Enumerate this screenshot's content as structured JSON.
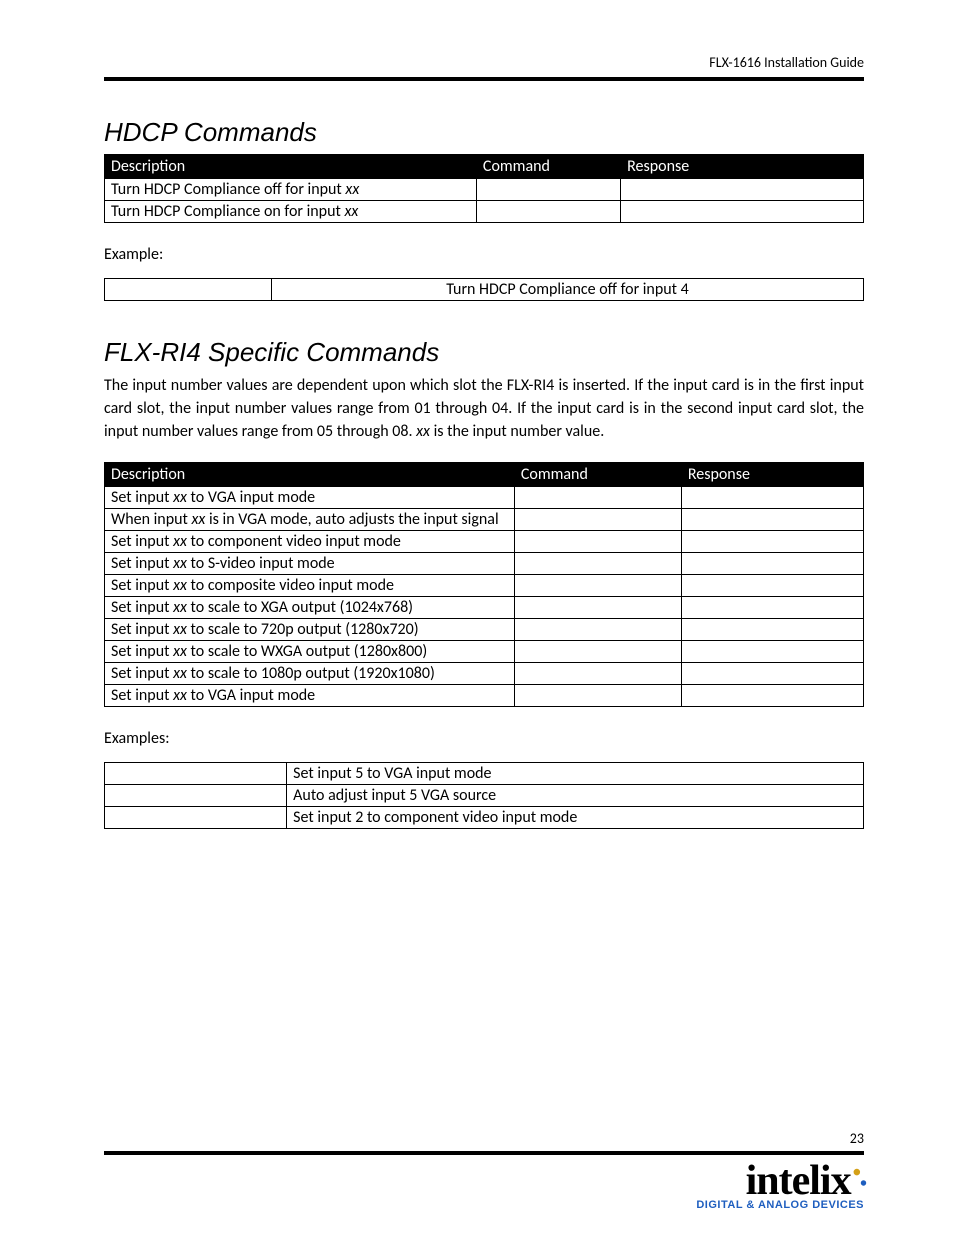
{
  "header": {
    "doc_title": "FLX-1616 Installation Guide"
  },
  "section1": {
    "title": "HDCP Commands",
    "headers": {
      "desc": "Description",
      "cmd": "Command",
      "resp": "Response"
    },
    "rows": [
      {
        "desc_pre": "Turn HDCP Compliance off for input ",
        "desc_it": "xx",
        "cmd": "",
        "resp": ""
      },
      {
        "desc_pre": "Turn HDCP Compliance on for input ",
        "desc_it": "xx",
        "cmd": "",
        "resp": ""
      }
    ],
    "example_label": "Example:",
    "example_rows": [
      {
        "c1": "",
        "c2": "Turn HDCP Compliance off for input 4"
      }
    ]
  },
  "section2": {
    "title": "FLX-RI4 Specific Commands",
    "paragraph_pre": "The input number values are dependent upon which slot the FLX-RI4 is inserted. If the input card is in the first input card slot, the input number values range from 01 through 04. If the input card is in the second input card slot, the input number values range from 05 through 08. ",
    "paragraph_it": "xx",
    "paragraph_post": " is the input number value.",
    "headers": {
      "desc": "Description",
      "cmd": "Command",
      "resp": "Response"
    },
    "rows": [
      {
        "p1": "Set input ",
        "it": "xx",
        "p2": " to VGA input mode",
        "cmd": "",
        "resp": ""
      },
      {
        "p1": "When input ",
        "it": "xx",
        "p2": " is in VGA mode, auto adjusts the input signal",
        "cmd": "",
        "resp": "",
        "justify": true
      },
      {
        "p1": "Set input ",
        "it": "xx",
        "p2": " to component video input mode",
        "cmd": "",
        "resp": ""
      },
      {
        "p1": "Set input ",
        "it": "xx",
        "p2": " to S-video input mode",
        "cmd": "",
        "resp": ""
      },
      {
        "p1": "Set input ",
        "it": "xx",
        "p2": " to composite video input mode",
        "cmd": "",
        "resp": ""
      },
      {
        "p1": "Set input ",
        "it": "xx",
        "p2": " to scale to XGA output (1024x768)",
        "cmd": "",
        "resp": ""
      },
      {
        "p1": "Set input ",
        "it": "xx",
        "p2": " to scale to 720p output (1280x720)",
        "cmd": "",
        "resp": ""
      },
      {
        "p1": "Set input ",
        "it": "xx",
        "p2": " to scale to WXGA output (1280x800)",
        "cmd": "",
        "resp": ""
      },
      {
        "p1": "Set input ",
        "it": "xx",
        "p2": " to scale to 1080p output (1920x1080)",
        "cmd": "",
        "resp": ""
      },
      {
        "p1": "Set input ",
        "it": "xx",
        "p2": " to VGA input mode",
        "cmd": "",
        "resp": ""
      }
    ],
    "example_label": "Examples:",
    "example_rows": [
      {
        "c1": "",
        "c2": "Set input 5 to VGA input mode"
      },
      {
        "c1": "",
        "c2": "Auto adjust input 5 VGA source"
      },
      {
        "c1": "",
        "c2": "Set input 2 to component video input mode"
      }
    ]
  },
  "footer": {
    "page": "23",
    "logo_text": "intelix",
    "logo_sub": "DIGITAL & ANALOG DEVICES"
  }
}
